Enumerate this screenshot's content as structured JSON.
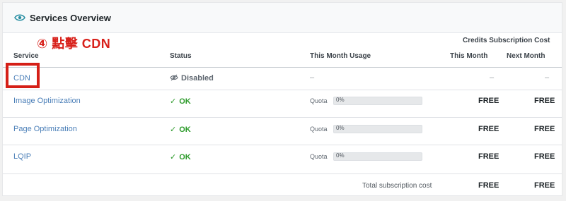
{
  "header": {
    "title": "Services Overview",
    "icon": "eye-icon"
  },
  "annotation": {
    "text": "④ 點擊 CDN",
    "color": "#d8211b"
  },
  "columns": {
    "group_label": "Credits Subscription Cost",
    "service": "Service",
    "status": "Status",
    "usage": "This Month Usage",
    "this_month": "This Month",
    "next_month": "Next Month"
  },
  "rows": [
    {
      "service": "CDN",
      "status": "Disabled",
      "status_icon": "eye-off-icon",
      "usage": "–",
      "this_month": "–",
      "next_month": "–"
    },
    {
      "service": "Image Optimization",
      "status": "OK",
      "status_icon": "check-icon",
      "quota_label": "Quota",
      "quota_value": "0%",
      "this_month": "FREE",
      "next_month": "FREE"
    },
    {
      "service": "Page Optimization",
      "status": "OK",
      "status_icon": "check-icon",
      "quota_label": "Quota",
      "quota_value": "0%",
      "this_month": "FREE",
      "next_month": "FREE"
    },
    {
      "service": "LQIP",
      "status": "OK",
      "status_icon": "check-icon",
      "quota_label": "Quota",
      "quota_value": "0%",
      "this_month": "FREE",
      "next_month": "FREE"
    }
  ],
  "footer": {
    "total_label": "Total subscription cost",
    "this_month": "FREE",
    "next_month": "FREE"
  },
  "colors": {
    "link": "#4b7fb8",
    "ok": "#2e9b2c",
    "highlight": "#d51f17"
  }
}
